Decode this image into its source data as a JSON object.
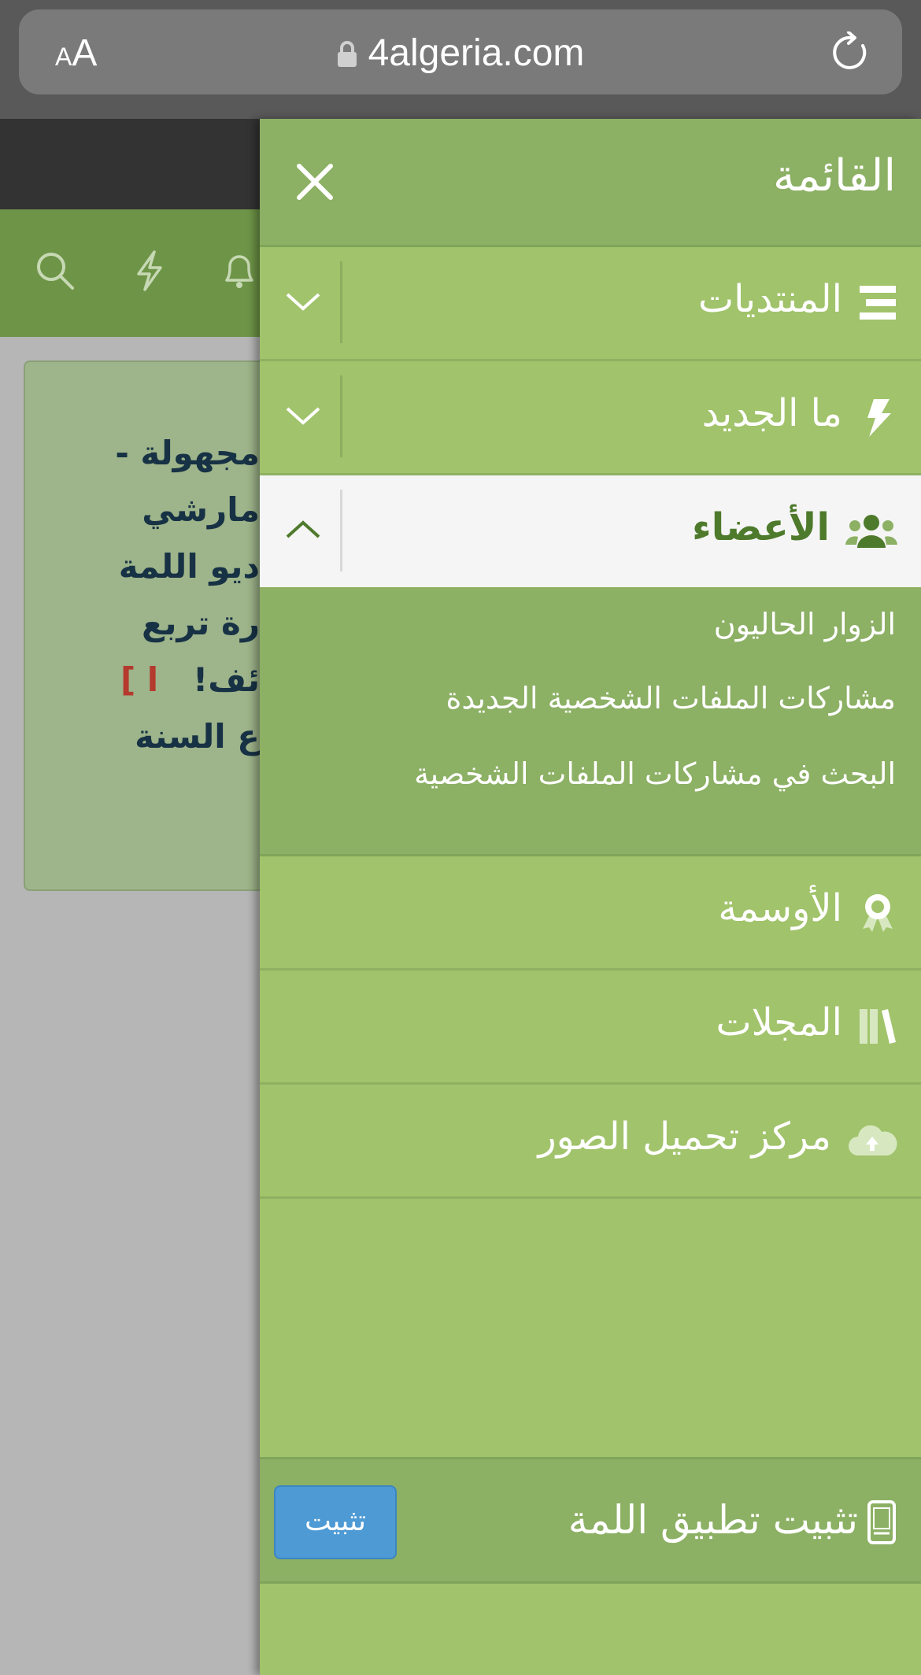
{
  "browser": {
    "text_size_label": "AA",
    "url": "4algeria.com"
  },
  "background_card": {
    "lines": [
      {
        "text": "مجهولة -"
      },
      {
        "text": "مارشي"
      },
      {
        "text": "ديو اللمة"
      },
      {
        "text": "رة تربع"
      },
      {
        "text": "ئف!",
        "suffix": "ا ]"
      },
      {
        "text": "ع السنة"
      }
    ]
  },
  "drawer": {
    "title": "القائمة",
    "items": [
      {
        "label": "المنتديات",
        "icon": "forums-icon",
        "expandable": true
      },
      {
        "label": "ما الجديد",
        "icon": "bolt-icon",
        "expandable": true
      },
      {
        "label": "الأعضاء",
        "icon": "users-icon",
        "expandable": true,
        "expanded": true
      }
    ],
    "submenu": [
      {
        "label": "الزوار الحاليون"
      },
      {
        "label": "مشاركات الملفات الشخصية الجديدة"
      },
      {
        "label": "البحث في مشاركات الملفات الشخصية"
      }
    ],
    "more_items": [
      {
        "label": "الأوسمة",
        "icon": "award-icon"
      },
      {
        "label": "المجلات",
        "icon": "books-icon"
      },
      {
        "label": "مركز تحميل الصور",
        "icon": "cloud-upload-icon"
      }
    ],
    "install": {
      "label": "تثبيت تطبيق اللمة",
      "button_label": "تثبيت",
      "icon": "phone-icon"
    }
  },
  "colors": {
    "drawer_bg": "#a1c36b",
    "drawer_header": "#8cb064",
    "active_text": "#4e7a2c",
    "install_button": "#4d9ad4"
  }
}
